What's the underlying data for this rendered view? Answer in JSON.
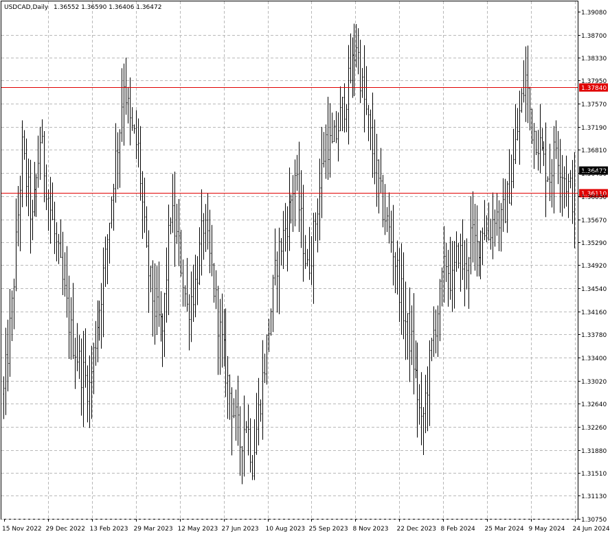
{
  "chart_data": {
    "type": "bar",
    "title": "USDCAD,Daily",
    "ohlc": "1.36552 1.36590 1.36406 1.36472",
    "xlabel": "",
    "ylabel": "",
    "ylim": [
      1.3075,
      1.3925
    ],
    "grid": true,
    "y_ticks": [
      "1.39080",
      "1.38700",
      "1.38330",
      "1.37950",
      "1.37570",
      "1.37190",
      "1.36810",
      "1.36430",
      "1.36050",
      "1.35670",
      "1.35290",
      "1.34920",
      "1.34540",
      "1.34160",
      "1.33780",
      "1.33400",
      "1.33020",
      "1.32640",
      "1.32260",
      "1.31880",
      "1.31510",
      "1.31130",
      "1.30750"
    ],
    "x_ticks": [
      "15 Nov 2022",
      "29 Dec 2022",
      "13 Feb 2023",
      "29 Mar 2023",
      "12 May 2023",
      "27 Jun 2023",
      "10 Aug 2023",
      "25 Sep 2023",
      "8 Nov 2023",
      "22 Dec 2023",
      "8 Feb 2024",
      "25 Mar 2024",
      "9 May 2024",
      "24 Jun 2024"
    ],
    "levels": [
      {
        "value": 1.3784,
        "label": "1.37840",
        "color": "#e00000"
      },
      {
        "value": 1.3611,
        "label": "1.36110",
        "color": "#e00000"
      }
    ],
    "last_price": {
      "value": 1.36472,
      "label": "1.36472"
    },
    "anchors": [
      [
        0,
        1.328
      ],
      [
        4,
        1.342
      ],
      [
        9,
        1.368
      ],
      [
        14,
        1.356
      ],
      [
        18,
        1.37
      ],
      [
        24,
        1.356
      ],
      [
        28,
        1.348
      ],
      [
        33,
        1.338
      ],
      [
        38,
        1.332
      ],
      [
        42,
        1.329
      ],
      [
        46,
        1.34
      ],
      [
        50,
        1.35
      ],
      [
        54,
        1.364
      ],
      [
        57,
        1.372
      ],
      [
        59,
        1.38
      ],
      [
        62,
        1.372
      ],
      [
        66,
        1.368
      ],
      [
        70,
        1.35
      ],
      [
        74,
        1.342
      ],
      [
        78,
        1.338
      ],
      [
        82,
        1.358
      ],
      [
        86,
        1.352
      ],
      [
        90,
        1.342
      ],
      [
        94,
        1.346
      ],
      [
        98,
        1.356
      ],
      [
        102,
        1.348
      ],
      [
        106,
        1.338
      ],
      [
        110,
        1.33
      ],
      [
        113,
        1.325
      ],
      [
        116,
        1.32
      ],
      [
        119,
        1.324
      ],
      [
        122,
        1.317
      ],
      [
        125,
        1.325
      ],
      [
        128,
        1.333
      ],
      [
        131,
        1.342
      ],
      [
        134,
        1.35
      ],
      [
        137,
        1.354
      ],
      [
        140,
        1.358
      ],
      [
        143,
        1.364
      ],
      [
        146,
        1.356
      ],
      [
        149,
        1.348
      ],
      [
        152,
        1.354
      ],
      [
        155,
        1.362
      ],
      [
        158,
        1.37
      ],
      [
        161,
        1.368
      ],
      [
        164,
        1.372
      ],
      [
        167,
        1.376
      ],
      [
        170,
        1.38
      ],
      [
        173,
        1.386
      ],
      [
        176,
        1.378
      ],
      [
        179,
        1.372
      ],
      [
        182,
        1.366
      ],
      [
        185,
        1.36
      ],
      [
        188,
        1.356
      ],
      [
        191,
        1.352
      ],
      [
        194,
        1.346
      ],
      [
        197,
        1.34
      ],
      [
        200,
        1.336
      ],
      [
        203,
        1.328
      ],
      [
        205,
        1.322
      ],
      [
        208,
        1.33
      ],
      [
        211,
        1.338
      ],
      [
        214,
        1.344
      ],
      [
        217,
        1.35
      ],
      [
        220,
        1.346
      ],
      [
        223,
        1.352
      ],
      [
        226,
        1.348
      ],
      [
        229,
        1.354
      ],
      [
        232,
        1.352
      ],
      [
        235,
        1.356
      ],
      [
        238,
        1.354
      ],
      [
        241,
        1.358
      ],
      [
        244,
        1.356
      ],
      [
        247,
        1.36
      ],
      [
        250,
        1.366
      ],
      [
        253,
        1.374
      ],
      [
        256,
        1.38
      ],
      [
        259,
        1.372
      ],
      [
        262,
        1.37
      ],
      [
        265,
        1.366
      ],
      [
        268,
        1.364
      ],
      [
        271,
        1.369
      ],
      [
        274,
        1.365
      ],
      [
        277,
        1.362
      ],
      [
        280,
        1.36
      ]
    ],
    "series": [
      {
        "values": "generated daily OHLC bars interpolated from anchors"
      }
    ]
  }
}
